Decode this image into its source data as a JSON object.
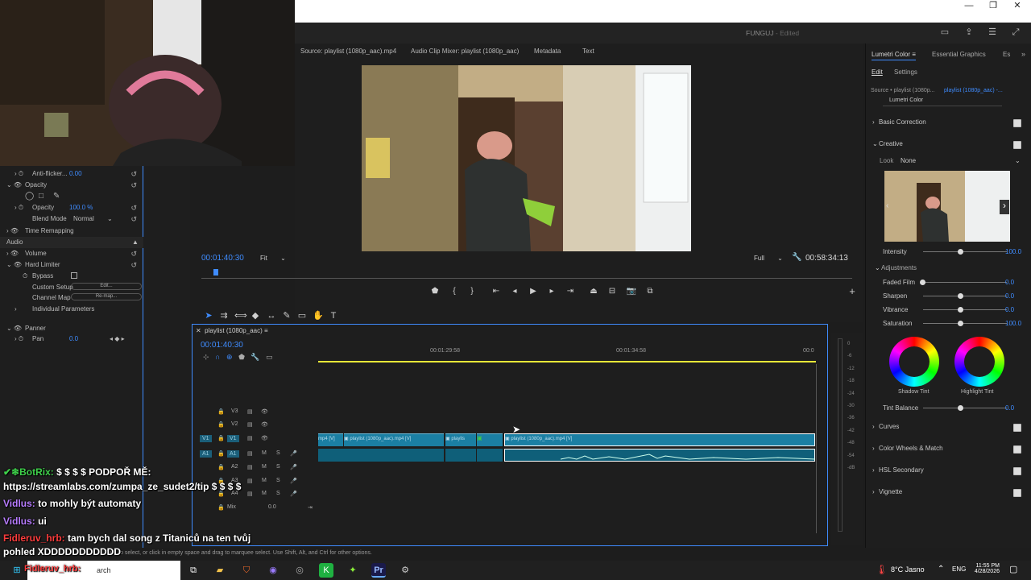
{
  "window": {
    "title": "FUNGUJ",
    "title_state": "Edited"
  },
  "source_tabs": [
    "Source: playlist (1080p_aac).mp4",
    "Audio Clip Mixer: playlist (1080p_aac)",
    "Metadata",
    "Text"
  ],
  "program": {
    "timecode": "00:01:40:30",
    "fit": "Fit",
    "quality": "Full",
    "duration": "00:58:34:13"
  },
  "effect_controls": {
    "anti_flicker_label": "Anti-flicker...",
    "anti_flicker_value": "0.00",
    "opacity_header": "Opacity",
    "opacity_label": "Opacity",
    "opacity_value": "100.0 %",
    "blend_label": "Blend Mode",
    "blend_value": "Normal",
    "time_remap": "Time Remapping",
    "audio": "Audio",
    "volume": "Volume",
    "hard_limiter": "Hard Limiter",
    "bypass": "Bypass",
    "custom_setup": "Custom Setup",
    "custom_setup_btn": "Edit...",
    "channel_map": "Channel Map",
    "channel_map_btn": "Re-map...",
    "individual": "Individual Parameters",
    "panner": "Panner",
    "pan": "Pan",
    "pan_value": "0.0"
  },
  "timeline": {
    "sequence": "playlist (1080p_aac)",
    "timecode": "00:01:40:30",
    "ruler": [
      "00:01:29:58",
      "00:01:34:58",
      "00:0"
    ],
    "video_tracks": [
      "V3",
      "V2",
      "V1"
    ],
    "audio_tracks": [
      "A1",
      "A2",
      "A3",
      "A4"
    ],
    "source_v": "V1",
    "source_a": "A1",
    "mix_label": "Mix",
    "mix_value": "0.0",
    "clip1": "mp4 [V]",
    "clip2": "playlist (1080p_aac).mp4 [V]",
    "clip3": "playlis",
    "clip4": "playlist (1080p_aac).mp4 [V]",
    "status": "Click to select, or click in empty space and drag to marquee select. Use Shift, Alt, and Ctrl for other options.",
    "meter_labels": [
      "0",
      "-6",
      "-12",
      "-18",
      "-24",
      "-30",
      "-36",
      "-42",
      "-48",
      "-54",
      "-dB"
    ]
  },
  "lumetri": {
    "tabs": [
      "Lumetri Color",
      "Essential Graphics",
      "Es"
    ],
    "subtabs": [
      "Edit",
      "Settings"
    ],
    "source": "Source • playlist (1080p...",
    "source_link": "playlist (1080p_aac) -...",
    "effect": "Lumetri Color",
    "basic": "Basic Correction",
    "creative": "Creative",
    "look_label": "Look",
    "look_value": "None",
    "intensity": "Intensity",
    "intensity_value": "100.0",
    "adjustments": "Adjustments",
    "faded": "Faded Film",
    "faded_value": "0.0",
    "sharpen": "Sharpen",
    "sharpen_value": "0.0",
    "vibrance": "Vibrance",
    "vibrance_value": "0.0",
    "saturation": "Saturation",
    "saturation_value": "100.0",
    "shadow": "Shadow Tint",
    "highlight": "Highlight Tint",
    "tint_balance": "Tint Balance",
    "tint_balance_value": "0.0",
    "curves": "Curves",
    "wheels": "Color Wheels & Match",
    "hsl": "HSL Secondary",
    "vignette": "Vignette"
  },
  "chat": [
    {
      "user": "BotRix:",
      "text": "$ $ $ $ PODPOŘ MĚ:"
    },
    {
      "user": "",
      "text": "https://streamlabs.com/zumpa_ze_sudet2/tip $ $ $ $"
    },
    {
      "user": "Vidlus:",
      "text": "to mohly být automaty"
    },
    {
      "user": "Vidlus:",
      "text": "ui"
    },
    {
      "user": "Fidleruv_hrb:",
      "text": "tam bych dal song z Titaniců na ten tvůj"
    },
    {
      "user": "",
      "text": "pohled XDDDDDDDDDDD"
    }
  ],
  "taskbar": {
    "search": "arch",
    "search_overlay": "Fidleruv_hrb:",
    "weather": "8°C Jasno",
    "lang": "ENG",
    "time": "11:55 PM",
    "date": "4/28/2026"
  },
  "colors": {
    "accent": "#3f8cff",
    "playhead": "#e8e838",
    "clip": "#1b7fa3",
    "botrix": "#3ecf4a",
    "vidlus": "#b77cff",
    "fidler": "#ff3d3d"
  }
}
